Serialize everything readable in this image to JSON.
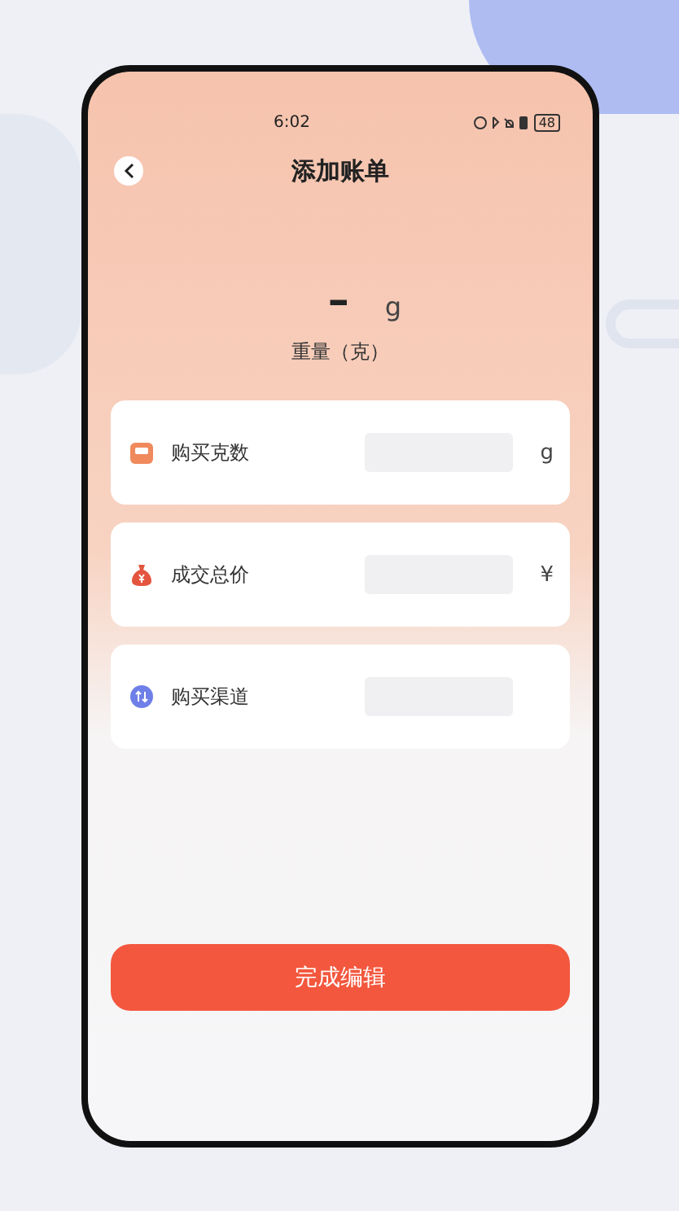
{
  "status_bar": {
    "time": "6:02",
    "battery": "48"
  },
  "header": {
    "title": "添加账单"
  },
  "weight": {
    "value": "–",
    "unit": "g",
    "label": "重量（克）"
  },
  "fields": [
    {
      "kind": "scale",
      "label": "购买克数",
      "unit": "g"
    },
    {
      "kind": "moneybag",
      "label": "成交总价",
      "unit": "¥"
    },
    {
      "kind": "channel",
      "label": "购买渠道"
    }
  ],
  "button": {
    "label": "完成编辑"
  }
}
